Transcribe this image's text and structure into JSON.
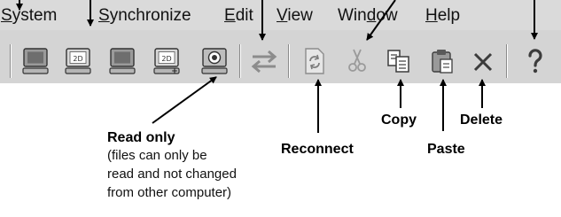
{
  "menu": {
    "system": {
      "accel": "S",
      "rest": "ystem"
    },
    "synchronize": {
      "accel": "S",
      "rest": "ynchronize"
    },
    "edit": {
      "accel": "E",
      "rest": "dit"
    },
    "view": {
      "accel": "V",
      "rest": "iew"
    },
    "window": {
      "pre": "Win",
      "accel": "d",
      "rest": "ow"
    },
    "help": {
      "accel": "H",
      "rest": "elp"
    }
  },
  "toolbar": {
    "buttons": [
      {
        "icon": "computer-icon"
      },
      {
        "icon": "computer-2d-icon"
      },
      {
        "icon": "computer-icon"
      },
      {
        "icon": "computer-2d-plus-icon"
      },
      {
        "icon": "read-only-icon"
      },
      {
        "icon": "synchronize-arrows-icon"
      },
      {
        "icon": "reconnect-icon"
      },
      {
        "icon": "cut-icon"
      },
      {
        "icon": "copy-icon"
      },
      {
        "icon": "paste-icon"
      },
      {
        "icon": "delete-icon"
      },
      {
        "icon": "help-icon"
      }
    ]
  },
  "callouts": {
    "read_only": "Read only",
    "read_only_note": [
      "(files can only be",
      "read and not changed",
      "from other computer)"
    ],
    "reconnect": "Reconnect",
    "copy": "Copy",
    "paste": "Paste",
    "delete": "Delete"
  },
  "colors": {
    "menubar_bg": "#dadada",
    "toolbar_bg": "#d4d4d4",
    "icon_gray": "#8c8c8c",
    "icon_dark": "#3c3c3c",
    "arrow": "#000000"
  }
}
